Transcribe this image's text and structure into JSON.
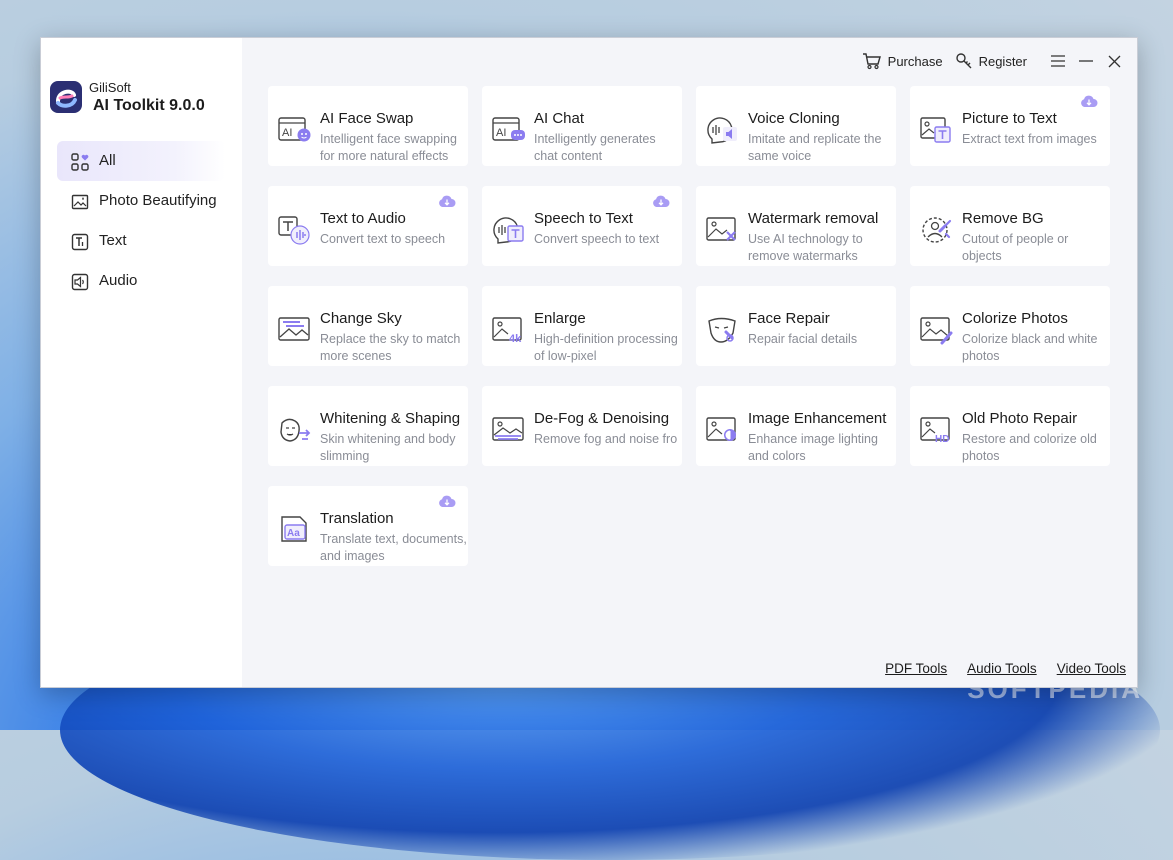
{
  "app": {
    "brand_name": "GiliSoft",
    "title": "AI Toolkit 9.0.0"
  },
  "topbar": {
    "purchase_label": "Purchase",
    "register_label": "Register"
  },
  "sidebar": {
    "items": [
      {
        "label": "All",
        "icon": "grid-heart-icon",
        "active": true
      },
      {
        "label": "Photo Beautifying",
        "icon": "photo-magic-icon"
      },
      {
        "label": "Text",
        "icon": "text-icon"
      },
      {
        "label": "Audio",
        "icon": "audio-icon"
      }
    ]
  },
  "tools": [
    {
      "title": "AI Face Swap",
      "desc": "Intelligent face swapping for more natural effects",
      "icon": "face-swap-icon",
      "download": false
    },
    {
      "title": "AI Chat",
      "desc": "Intelligently generates chat content",
      "icon": "ai-chat-icon",
      "download": false
    },
    {
      "title": "Voice Cloning",
      "desc": "Imitate and replicate the same voice",
      "icon": "voice-cloning-icon",
      "download": false
    },
    {
      "title": "Picture to Text",
      "desc": "Extract text from images",
      "icon": "picture-to-text-icon",
      "download": true
    },
    {
      "title": "Text to Audio",
      "desc": "Convert text to speech",
      "icon": "text-to-audio-icon",
      "download": true
    },
    {
      "title": "Speech to Text",
      "desc": "Convert speech to text",
      "icon": "speech-to-text-icon",
      "download": true
    },
    {
      "title": "Watermark removal",
      "desc": "Use AI technology to remove watermarks",
      "icon": "watermark-removal-icon",
      "download": false
    },
    {
      "title": "Remove BG",
      "desc": "Cutout of people or objects",
      "icon": "remove-bg-icon",
      "download": false
    },
    {
      "title": "Change Sky",
      "desc": "Replace the sky to match more scenes",
      "icon": "change-sky-icon",
      "download": false
    },
    {
      "title": "Enlarge",
      "desc": "High-definition processing of low-pixel",
      "icon": "enlarge-4k-icon",
      "download": false
    },
    {
      "title": "Face Repair",
      "desc": "Repair facial details",
      "icon": "face-repair-icon",
      "download": false
    },
    {
      "title": "Colorize Photos",
      "desc": "Colorize black and white photos",
      "icon": "colorize-photos-icon",
      "download": false
    },
    {
      "title": "Whitening & Shaping",
      "desc": "Skin whitening and body slimming",
      "icon": "whitening-shaping-icon",
      "download": false
    },
    {
      "title": "De-Fog & Denoising",
      "desc": "Remove fog and noise fro",
      "icon": "defog-icon",
      "download": false
    },
    {
      "title": "Image Enhancement",
      "desc": "Enhance image lighting and colors",
      "icon": "image-enhancement-icon",
      "download": false
    },
    {
      "title": "Old Photo Repair",
      "desc": "Restore and colorize old photos",
      "icon": "old-photo-repair-icon",
      "download": false
    },
    {
      "title": "Translation",
      "desc": "Translate text, documents, and images",
      "icon": "translation-icon",
      "download": true
    }
  ],
  "footer": {
    "links": [
      "PDF Tools",
      "Audio Tools",
      "Video Tools"
    ]
  },
  "colors": {
    "accent": "#8b7cf0",
    "text": "#1c1c1c",
    "muted": "#8a8d96"
  }
}
